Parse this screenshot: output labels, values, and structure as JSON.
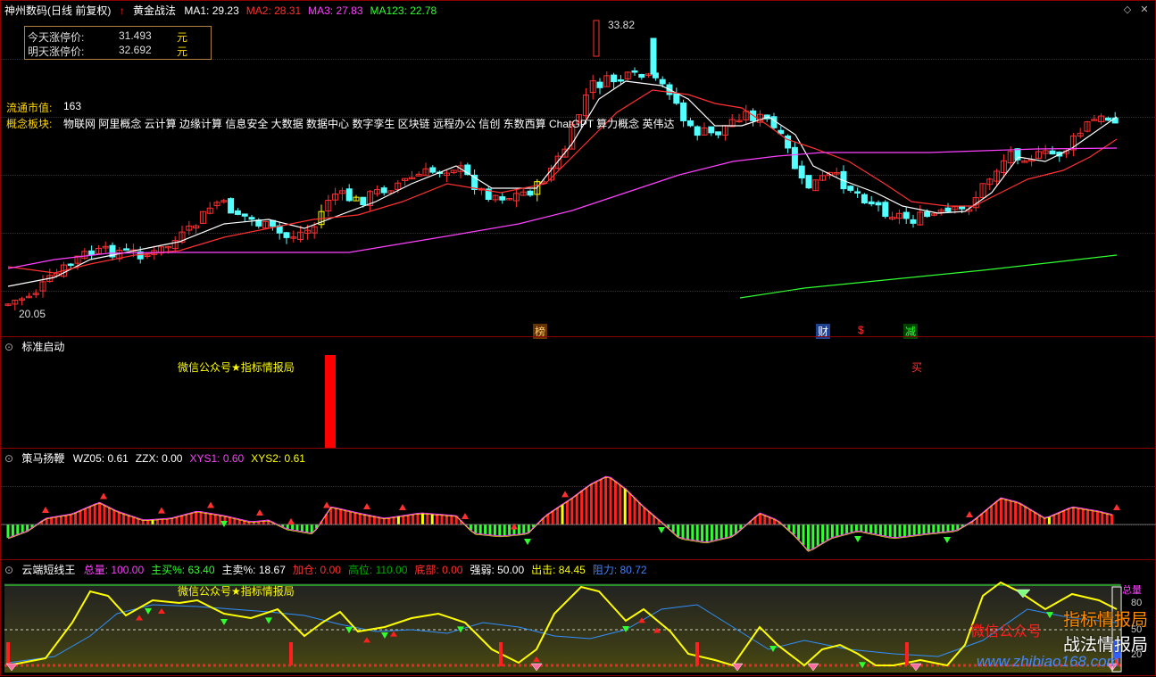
{
  "main": {
    "stock_name": "神州数码(日线 前复权)",
    "indicator": "黄金战法",
    "ma": [
      {
        "label": "MA1:",
        "value": "29.23",
        "color": "#ffffff"
      },
      {
        "label": "MA2:",
        "value": "28.31",
        "color": "#ff3030"
      },
      {
        "label": "MA3:",
        "value": "27.83",
        "color": "#ff40ff"
      },
      {
        "label": "MA123:",
        "value": "22.78",
        "color": "#30ff30"
      }
    ],
    "limit_box": {
      "today_label": "今天涨停价:",
      "today_value": "31.493",
      "today_unit": "元",
      "tomorrow_label": "明天涨停价:",
      "tomorrow_value": "32.692",
      "tomorrow_unit": "元"
    },
    "market_cap_label": "流通市值:",
    "market_cap_value": "163",
    "concept_label": "概念板块:",
    "concept_text": "物联网 阿里概念 云计算 边缘计算 信息安全 大数据 数据中心 数字孪生 区块链 远程办公 信创 东数西算 ChatGPT 算力概念 英伟达",
    "high_label": "33.82",
    "low_label": "20.05",
    "markers": [
      {
        "text": "榜",
        "color": "#ffcc66",
        "bg": "#663300"
      },
      {
        "text": "财",
        "color": "#ffffff",
        "bg": "#1f3f8f"
      },
      {
        "text": "$",
        "color": "#ff3030",
        "bg": "transparent"
      },
      {
        "text": "减",
        "color": "#30ff30",
        "bg": "#004400"
      }
    ],
    "colors": {
      "up": "#ff3030",
      "down": "#54ffff",
      "yellow": "#ffff00"
    }
  },
  "panel2": {
    "title": "标准启动",
    "watermark": "微信公众号★指标情报局",
    "buy_label": "买"
  },
  "panel3": {
    "title": "策马扬鞭",
    "values": [
      {
        "label": "WZ05:",
        "value": "0.61",
        "color": "#ffffff"
      },
      {
        "label": "ZZX:",
        "value": "0.00",
        "color": "#ffffff"
      },
      {
        "label": "XYS1:",
        "value": "0.60",
        "color": "#ff40ff"
      },
      {
        "label": "XYS2:",
        "value": "0.61",
        "color": "#ffff00"
      }
    ]
  },
  "panel4": {
    "title": "云端短线王",
    "values": [
      {
        "label": "总量:",
        "value": "100.00",
        "color": "#ff40ff"
      },
      {
        "label": "主买%:",
        "value": "63.40",
        "color": "#30ff30"
      },
      {
        "label": "主卖%:",
        "value": "18.67",
        "color": "#ffffff"
      },
      {
        "label": "加仓:",
        "value": "0.00",
        "color": "#ff3030"
      },
      {
        "label": "高位:",
        "value": "110.00",
        "color": "#00aa00"
      },
      {
        "label": "底部:",
        "value": "0.00",
        "color": "#ff3030"
      },
      {
        "label": "强弱:",
        "value": "50.00",
        "color": "#ffffff"
      },
      {
        "label": "出击:",
        "value": "84.45",
        "color": "#ffff00"
      },
      {
        "label": "阻力:",
        "value": "80.72",
        "color": "#4080ff"
      }
    ],
    "watermark": "微信公众号★指标情报局",
    "overlay_left": "微信公众号",
    "overlay_right1": "指标情报局",
    "overlay_right2": "战法情报局",
    "site": "www.zhibiao168.com",
    "axis": [
      "总量",
      "80",
      "50",
      "20"
    ]
  },
  "window": {
    "close": "✕",
    "restore": "◇"
  }
}
